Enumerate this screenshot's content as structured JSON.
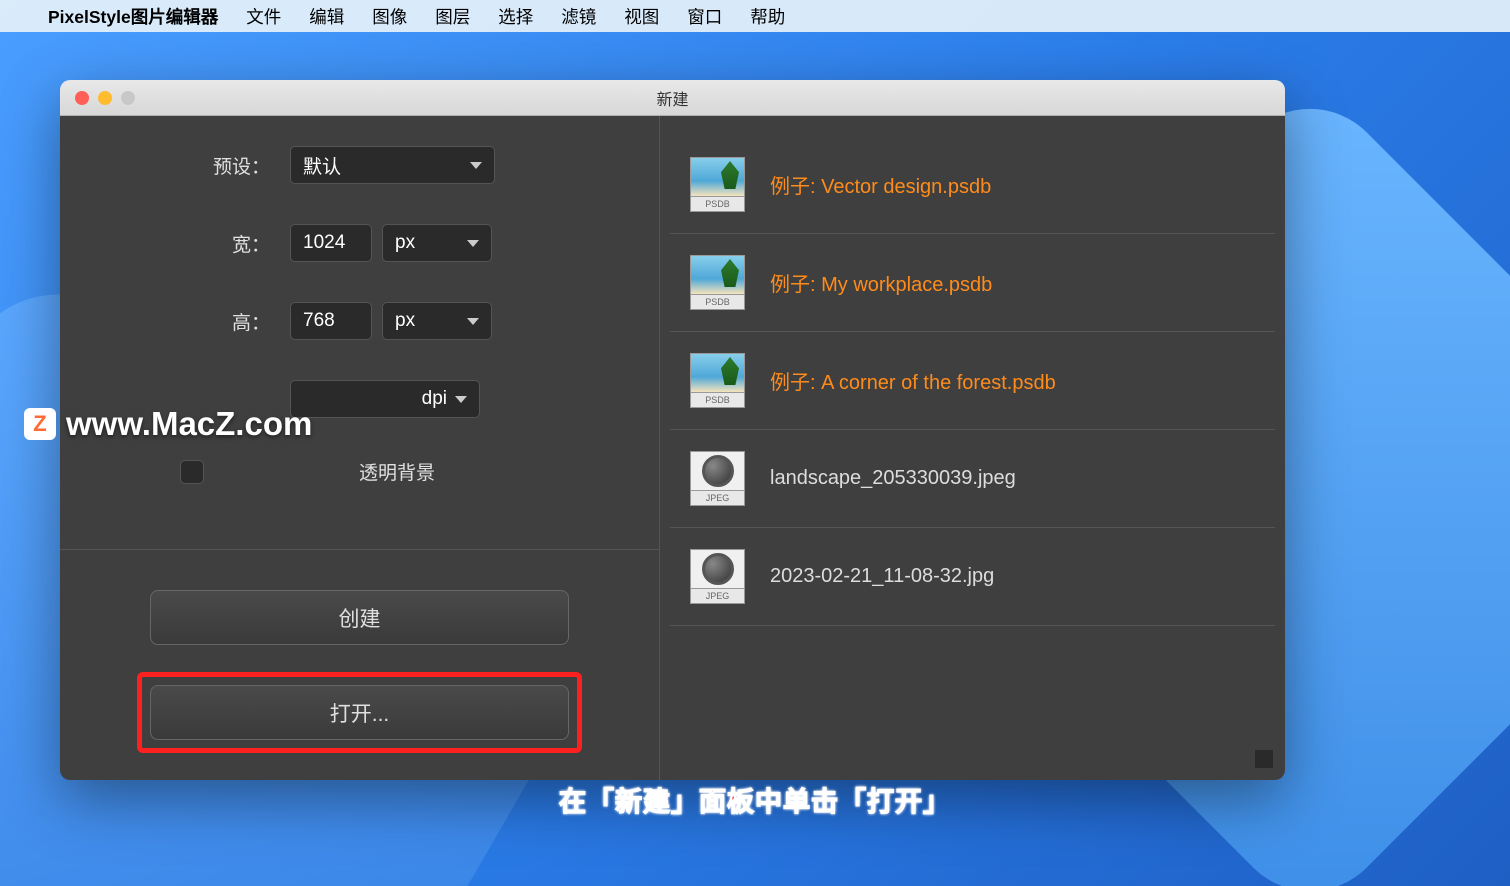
{
  "menubar": {
    "app_name": "PixelStyle图片编辑器",
    "items": [
      "文件",
      "编辑",
      "图像",
      "图层",
      "选择",
      "滤镜",
      "视图",
      "窗口",
      "帮助"
    ]
  },
  "dialog": {
    "title": "新建",
    "form": {
      "preset_label": "预设：",
      "preset_value": "默认",
      "width_label": "宽：",
      "width_value": "1024",
      "width_unit": "px",
      "height_label": "高：",
      "height_value": "768",
      "height_unit": "px",
      "resolution_suffix": "dpi",
      "transparent_label": "透明背景"
    },
    "buttons": {
      "create": "创建",
      "open": "打开..."
    },
    "files": [
      {
        "name": "例子: Vector design.psdb",
        "type": "PSDB",
        "example": true
      },
      {
        "name": "例子: My workplace.psdb",
        "type": "PSDB",
        "example": true
      },
      {
        "name": "例子: A corner of the forest.psdb",
        "type": "PSDB",
        "example": true
      },
      {
        "name": "landscape_205330039.jpeg",
        "type": "JPEG",
        "example": false
      },
      {
        "name": "2023-02-21_11-08-32.jpg",
        "type": "JPEG",
        "example": false
      }
    ]
  },
  "watermark": {
    "icon_letter": "Z",
    "text": "www.MacZ.com"
  },
  "caption": "在「新建」面板中单击「打开」"
}
